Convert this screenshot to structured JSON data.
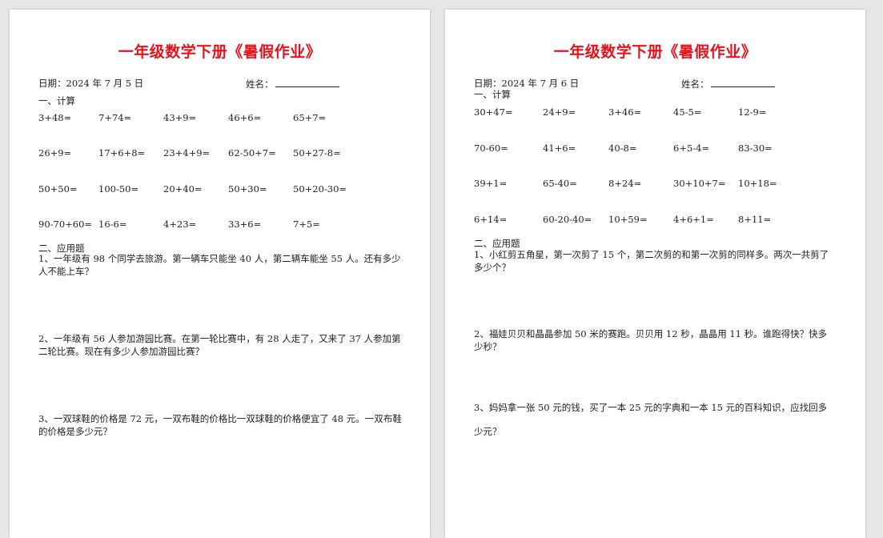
{
  "pages": [
    {
      "title": "一年级数学下册《暑假作业》",
      "date": "日期：2024 年 7 月 5 日",
      "name_label": "姓名：",
      "section1": "一、计算",
      "rows": [
        [
          "3+48=",
          "7+74=",
          "43+9=",
          "46+6=",
          "65+7="
        ],
        [
          "26+9=",
          "17+6+8=",
          "23+4+9=",
          "62-50+7=",
          "50+27-8="
        ],
        [
          "50+50=",
          "100-50=",
          "20+40=",
          "50+30=",
          "50+20-30="
        ],
        [
          "90-70+60=",
          "16-6=",
          "4+23=",
          "33+6=",
          "7+5="
        ]
      ],
      "section2": "二、应用题",
      "problems": [
        "1、一年级有 98 个同学去旅游。第一辆车只能坐 40 人，第二辆车能坐 55 人。还有多少人不能上车？",
        "2、一年级有 56 人参加游园比赛。在第一轮比赛中，有 28 人走了，又来了 37 人参加第二轮比赛。现在有多少人参加游园比赛？",
        "3、一双球鞋的价格是 72 元，一双布鞋的价格比一双球鞋的价格便宜了 48 元。一双布鞋的价格是多少元？"
      ]
    },
    {
      "title": "一年级数学下册《暑假作业》",
      "date": "日期：2024 年 7 月 6 日",
      "name_label": "姓名：",
      "section1": "一、计算",
      "rows": [
        [
          "30+47=",
          "24+9=",
          "3+46=",
          "45-5=",
          "12-9="
        ],
        [
          "70-60=",
          "41+6=",
          "40-8=",
          "6+5-4=",
          "83-30="
        ],
        [
          "39+1=",
          "65-40=",
          "8+24=",
          "30+10+7=",
          "10+18="
        ],
        [
          "6+14=",
          "60-20-40=",
          "10+59=",
          "4+6+1=",
          "8+11="
        ]
      ],
      "section2": "二、应用题",
      "problems": [
        "1、小红剪五角星，第一次剪了 15 个，第二次剪的和第一次剪的同样多。两次一共剪了多少个？",
        "2、福娃贝贝和晶晶参加 50 米的赛跑。贝贝用 12 秒，晶晶用 11 秒。谁跑得快？快多少秒？",
        "3、妈妈拿一张 50 元的钱，买了一本 25 元的字典和一本 15 元的百科知识，应找回多少元？"
      ]
    }
  ]
}
